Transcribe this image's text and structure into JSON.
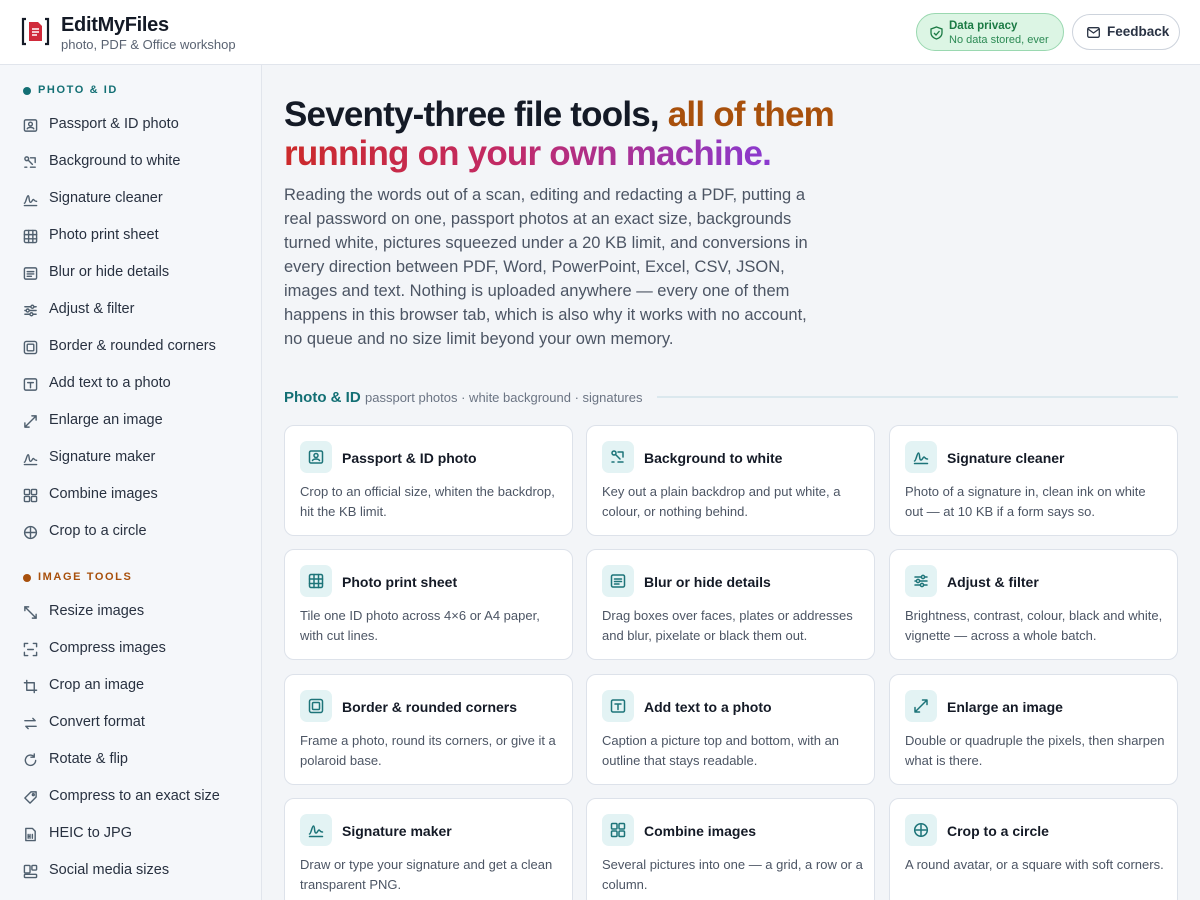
{
  "header": {
    "brand_name": "EditMyFiles",
    "brand_tagline": "photo, PDF & Office workshop",
    "privacy_title": "Data privacy",
    "privacy_subtitle": "No data stored, ever",
    "feedback_label": "Feedback"
  },
  "sidebar": {
    "sections": [
      {
        "label": "PHOTO & ID",
        "color": "#136f74",
        "items": [
          {
            "label": "Passport & ID photo",
            "icon": "id-card-icon"
          },
          {
            "label": "Background to white",
            "icon": "background-icon"
          },
          {
            "label": "Signature cleaner",
            "icon": "signature-icon"
          },
          {
            "label": "Photo print sheet",
            "icon": "grid-icon"
          },
          {
            "label": "Blur or hide details",
            "icon": "blur-icon"
          },
          {
            "label": "Adjust & filter",
            "icon": "sliders-icon"
          },
          {
            "label": "Border & rounded corners",
            "icon": "border-icon"
          },
          {
            "label": "Add text to a photo",
            "icon": "text-icon"
          },
          {
            "label": "Enlarge an image",
            "icon": "enlarge-icon"
          },
          {
            "label": "Signature maker",
            "icon": "signature-icon"
          },
          {
            "label": "Combine images",
            "icon": "combine-icon"
          },
          {
            "label": "Crop to a circle",
            "icon": "circle-crop-icon"
          }
        ]
      },
      {
        "label": "IMAGE TOOLS",
        "color": "#a8500c",
        "items": [
          {
            "label": "Resize images",
            "icon": "resize-icon"
          },
          {
            "label": "Compress images",
            "icon": "compress-icon"
          },
          {
            "label": "Crop an image",
            "icon": "crop-icon"
          },
          {
            "label": "Convert format",
            "icon": "convert-icon"
          },
          {
            "label": "Rotate & flip",
            "icon": "rotate-icon"
          },
          {
            "label": "Compress to an exact size",
            "icon": "tag-icon"
          },
          {
            "label": "HEIC to JPG",
            "icon": "file-icon"
          },
          {
            "label": "Social media sizes",
            "icon": "social-icon"
          }
        ]
      }
    ]
  },
  "hero": {
    "part1": "Seventy-three file tools, ",
    "part2": "all of them",
    "part3": "running on your own machine.",
    "intro": "Reading the words out of a scan, editing and redacting a PDF, putting a real password on one, passport photos at an exact size, backgrounds turned white, pictures squeezed under a 20 KB limit, and conversions in every direction between PDF, Word, PowerPoint, Excel, CSV, JSON, images and text. Nothing is uploaded anywhere — every one of them happens in this browser tab, which is also why it works with no account, no queue and no size limit beyond your own memory."
  },
  "group": {
    "title": "Photo & ID",
    "subtitle": "passport photos · white background · signatures"
  },
  "cards": [
    {
      "title": "Passport & ID photo",
      "desc": "Crop to an official size, whiten the backdrop, hit the KB limit.",
      "icon": "id-card-icon"
    },
    {
      "title": "Background to white",
      "desc": "Key out a plain backdrop and put white, a colour, or nothing behind.",
      "icon": "background-icon"
    },
    {
      "title": "Signature cleaner",
      "desc": "Photo of a signature in, clean ink on white out — at 10 KB if a form says so.",
      "icon": "signature-icon"
    },
    {
      "title": "Photo print sheet",
      "desc": "Tile one ID photo across 4×6 or A4 paper, with cut lines.",
      "icon": "grid-icon"
    },
    {
      "title": "Blur or hide details",
      "desc": "Drag boxes over faces, plates or addresses and blur, pixelate or black them out.",
      "icon": "blur-icon"
    },
    {
      "title": "Adjust & filter",
      "desc": "Brightness, contrast, colour, black and white, vignette — across a whole batch.",
      "icon": "sliders-icon"
    },
    {
      "title": "Border & rounded corners",
      "desc": "Frame a photo, round its corners, or give it a polaroid base.",
      "icon": "border-icon"
    },
    {
      "title": "Add text to a photo",
      "desc": "Caption a picture top and bottom, with an outline that stays readable.",
      "icon": "text-icon"
    },
    {
      "title": "Enlarge an image",
      "desc": "Double or quadruple the pixels, then sharpen what is there.",
      "icon": "enlarge-icon"
    },
    {
      "title": "Signature maker",
      "desc": "Draw or type your signature and get a clean transparent PNG.",
      "icon": "signature-icon"
    },
    {
      "title": "Combine images",
      "desc": "Several pictures into one — a grid, a row or a column.",
      "icon": "combine-icon"
    },
    {
      "title": "Crop to a circle",
      "desc": "A round avatar, or a square with soft corners.",
      "icon": "circle-crop-icon"
    }
  ]
}
